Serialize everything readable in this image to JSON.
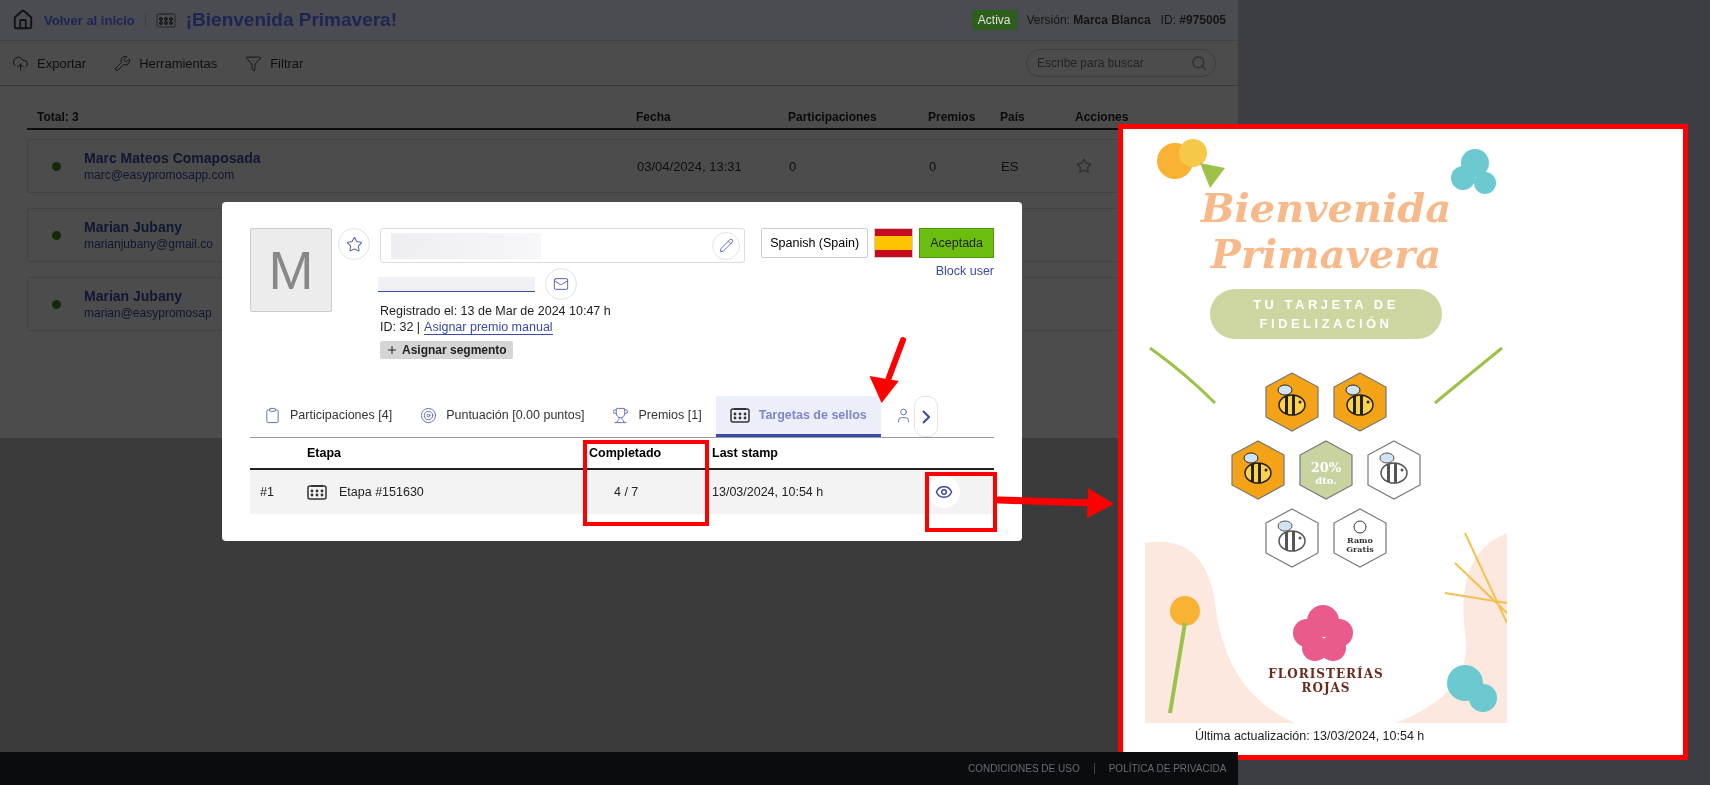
{
  "header": {
    "back_link": "Volver al inicio",
    "title": "¡Bienvenida Primavera!",
    "status": "Activa",
    "version": "Versión: **Marca Blanca**",
    "id": "ID: **#975005**"
  },
  "toolbar": {
    "actions": [
      "Exportar",
      "Herramientas",
      "Filtrar"
    ],
    "search": {
      "placeholder": "Escribe para buscar"
    }
  },
  "participants": {
    "total": "Total: 3",
    "columns": [
      "Fecha",
      "Participaciones",
      "Premios",
      "País",
      "Acciones"
    ],
    "rows": [
      {
        "name": "Marc Mateos Comaposada",
        "email": "marc@easypromosapp.com",
        "online": true,
        "date": "03/04/2024, 13:31",
        "participations": "0",
        "prizes": "0",
        "country": "ES"
      },
      {
        "name": "Marian Jubany",
        "email": "marianjubany@gmail.co",
        "online": true
      },
      {
        "name": "Marian Jubany",
        "email": "marian@easypromosap",
        "online": true
      }
    ]
  },
  "modal": {
    "avatar_initial": "M",
    "favorite": false,
    "registered": "Registrado el: 13 de Mar de 2024 10:47 h",
    "id": "ID: 32 |",
    "assign_prize_link": "Asignar premio manual",
    "segment_button": "Asignar segmento",
    "language": "Spanish (Spain)",
    "status": "Aceptada",
    "block_link": "Block user",
    "tabs": [
      {
        "label": "Participaciones [4]",
        "selected": false
      },
      {
        "label": "Puntuación [0.00 puntos]",
        "selected": false
      },
      {
        "label": "Premios [1]",
        "selected": false
      },
      {
        "label": "Targetas de sellos",
        "selected": true
      },
      {
        "selected": false
      }
    ],
    "stamps_table": {
      "columns": [
        "Etapa",
        "Completado",
        "Last stamp"
      ],
      "rows": [
        {
          "number": "#1",
          "stage": "Etapa #151630",
          "completed": "4 / 7",
          "last_stamp": "13/03/2024, 10:54 h"
        }
      ]
    }
  },
  "card_preview": {
    "title": "Bienvenida Primavera",
    "subtitle": "TU TARJETA DE FIDELIZACIÓN",
    "stamps": [
      {
        "kind": "bee",
        "stamped": true
      },
      {
        "kind": "bee",
        "stamped": true
      },
      {
        "kind": "bee",
        "stamped": true
      },
      {
        "kind": "prize",
        "stamped": true,
        "label": "20%",
        "sublabel": "dto."
      },
      {
        "kind": "bee",
        "stamped": false
      },
      {
        "kind": "bee",
        "stamped": false
      },
      {
        "kind": "prize",
        "stamped": false,
        "label": "Ramo",
        "sublabel": "Gratis"
      }
    ],
    "brand": "FLORISTERÍAS ROJAS",
    "updated": "Última actualización: 13/03/2024, 10:54 h"
  },
  "footer": {
    "links": [
      "CONDICIONES DE USO",
      "POLÍTICA DE PRIVACIDA"
    ]
  }
}
